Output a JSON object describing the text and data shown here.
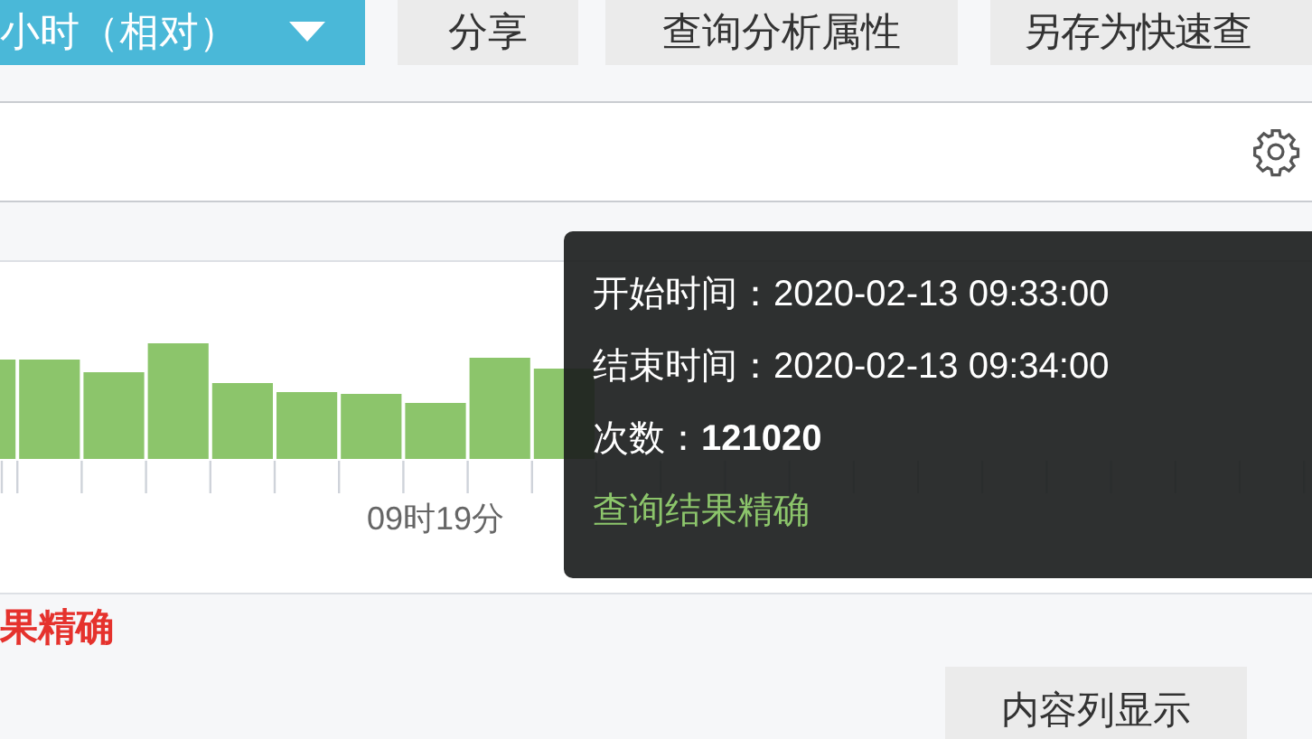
{
  "toolbar": {
    "time_range": {
      "label": "小时（相对）"
    },
    "buttons": [
      "分享",
      "查询分析属性",
      "另存为快速查"
    ]
  },
  "histogram": {
    "axis_labels": [
      "09时19分"
    ],
    "tooltip": {
      "rows": [
        "开始时间：2020-02-13 09:33:00",
        "结束时间：2020-02-13 09:34:00",
        "次数：**121020**"
      ],
      "status": "查询结果精确"
    }
  },
  "status_text": "果精确",
  "bottom_buttons": [
    "内容列显示"
  ]
}
